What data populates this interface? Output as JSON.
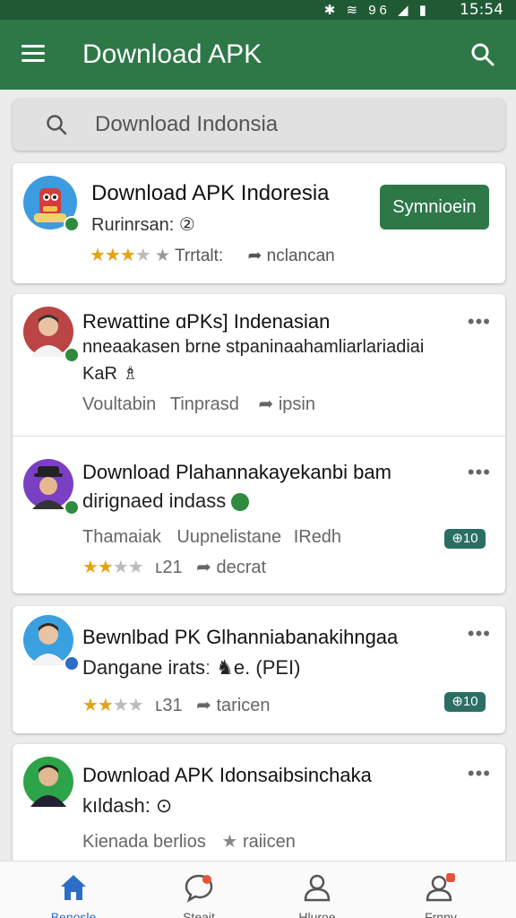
{
  "status": {
    "icons": "✱ ≋ 96 ◢ ▮",
    "time": "15:54"
  },
  "appbar": {
    "title": "Download APK"
  },
  "search": {
    "text": "Download Indonsia"
  },
  "featured": {
    "title": "Download APK Indoresia",
    "subtitle": "Rurinrsan: ②",
    "meta_a": "Trrtalt:",
    "meta_b": "nclancan",
    "install_label": "Symnioein"
  },
  "list": {
    "item1": {
      "title": "Rewattine ɑPKs] Indenasian",
      "line2": "nneaakasen brne stpaninaahamliarlariadiai",
      "line3": "KaR ♗",
      "meta_a": "Voultabin",
      "meta_b": "Tinprasd",
      "meta_c": "ipsin"
    },
    "item2": {
      "title": "Download Plahannakayekanbi bam",
      "line2": "dirignaed indass",
      "meta_a": "Thamaiak",
      "meta_b": "Uupnelistane",
      "meta_c": "IRedh",
      "pill": "⊕10",
      "meta_d": "ʟ21",
      "meta_e": "decrat"
    },
    "item3": {
      "title": "Bewnlbad PK Glhanniabanakihngaa",
      "line2": "Dangane iratsː ♞e. (PEI)",
      "pill": "⊕10",
      "meta_d": "ʟ31",
      "meta_e": "taricen"
    },
    "item4": {
      "title": "Download APK Idonsaibsinchaka",
      "line2": "kıldash: ⊙",
      "meta_a": "Kienada berlios",
      "meta_b": "raiicen"
    }
  },
  "bottomnav": {
    "home": "Benosle",
    "chat": "Steait",
    "user": "Hluroe",
    "profile": "Frnny"
  },
  "colors": {
    "primary": "#2e7848",
    "status": "#1f5a34",
    "active": "#2d6cc7",
    "star": "#e3a317"
  }
}
